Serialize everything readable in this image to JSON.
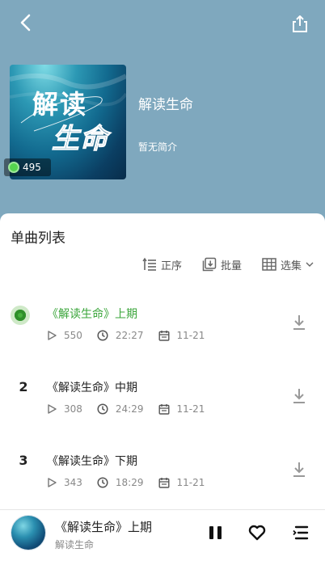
{
  "album": {
    "title": "解读生命",
    "description": "暂无简介",
    "cover_line1": "解读",
    "cover_line2": "生命",
    "play_count": "495"
  },
  "list": {
    "title": "单曲列表",
    "order_label": "正序",
    "batch_label": "批量",
    "select_label": "选集"
  },
  "tracks": [
    {
      "index": "",
      "title": "《解读生命》上期",
      "plays": "550",
      "duration": "22:27",
      "date": "11-21",
      "playing": true
    },
    {
      "index": "2",
      "title": "《解读生命》中期",
      "plays": "308",
      "duration": "24:29",
      "date": "11-21",
      "playing": false
    },
    {
      "index": "3",
      "title": "《解读生命》下期",
      "plays": "343",
      "duration": "18:29",
      "date": "11-21",
      "playing": false
    }
  ],
  "player": {
    "title": "《解读生命》上期",
    "subtitle": "解读生命"
  },
  "colors": {
    "header_bg": "#7fa8be",
    "accent_green": "#3aa53a",
    "meta_gray": "#888888"
  },
  "icons": [
    "back-icon",
    "share-icon",
    "order-icon",
    "batch-icon",
    "grid-icon",
    "chevron-down-icon",
    "play-icon",
    "clock-icon",
    "calendar-icon",
    "download-icon",
    "pause-icon",
    "heart-icon",
    "playlist-icon"
  ]
}
